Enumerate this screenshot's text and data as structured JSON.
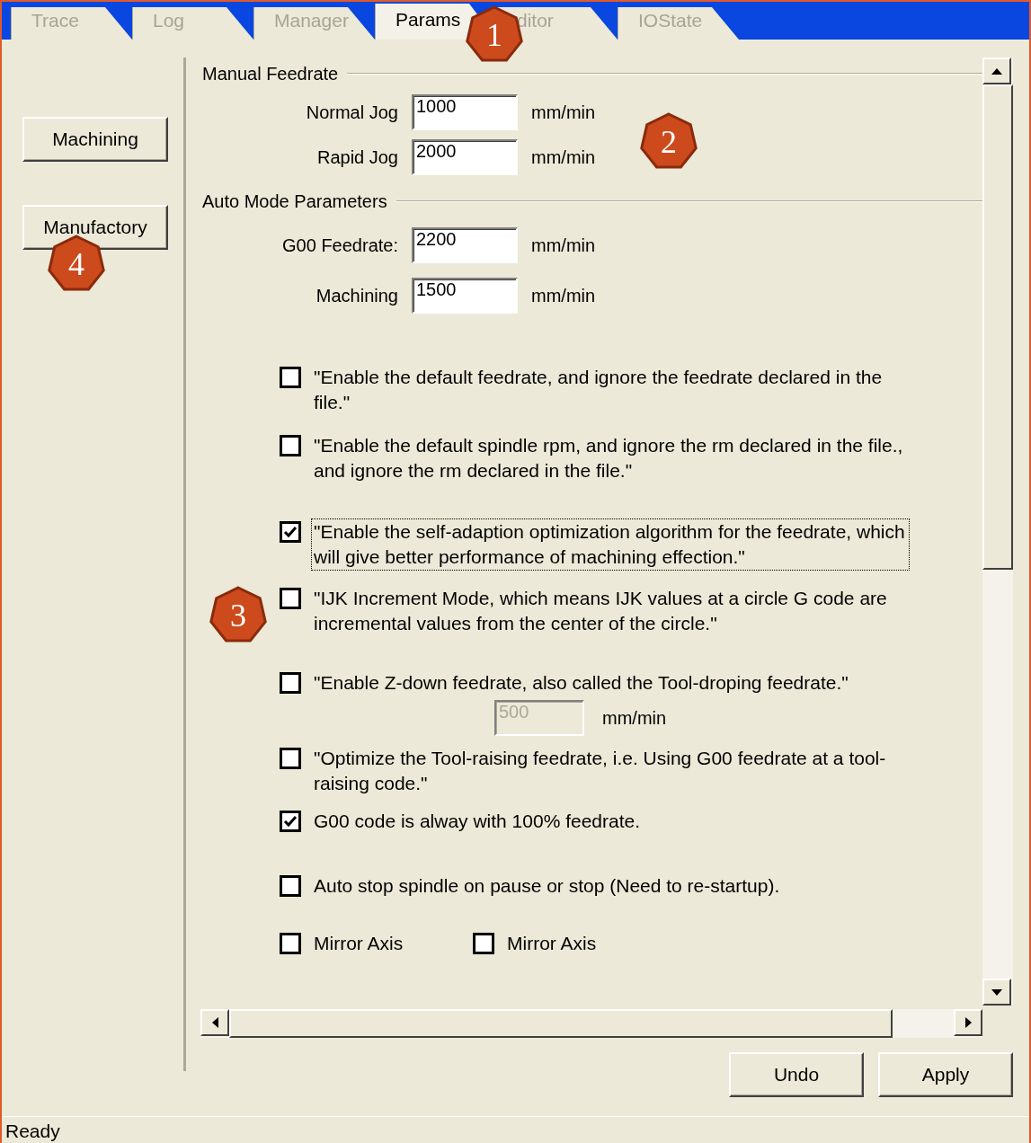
{
  "tabs": [
    {
      "label": "Trace",
      "selected": false
    },
    {
      "label": "Log",
      "selected": false
    },
    {
      "label": "Manager",
      "selected": false
    },
    {
      "label": "Params",
      "selected": true
    },
    {
      "label": "ditor",
      "selected": false
    },
    {
      "label": "IOState",
      "selected": false
    }
  ],
  "side_buttons": [
    {
      "label": "Machining"
    },
    {
      "label": "Manufactory"
    }
  ],
  "sections": [
    {
      "title": "Manual Feedrate",
      "fields": [
        {
          "label": "Normal Jog",
          "value": "1000",
          "unit": "mm/min"
        },
        {
          "label": "Rapid Jog",
          "value": "2000",
          "unit": "mm/min"
        }
      ]
    },
    {
      "title": "Auto Mode Parameters",
      "fields": [
        {
          "label": "G00 Feedrate:",
          "value": "2200",
          "unit": "mm/min"
        },
        {
          "label": "Machining",
          "value": "1500",
          "unit": "mm/min"
        }
      ]
    }
  ],
  "options": [
    {
      "kind": "checkbox",
      "text": "\"Enable the default feedrate, and ignore the feedrate declared in the file.\"",
      "checked": false
    },
    {
      "kind": "checkbox",
      "text": "\"Enable the default spindle rpm, and ignore the rm declared in the file., and ignore the rm declared in the file.\"",
      "checked": false
    },
    {
      "kind": "checkbox",
      "text": "\"Enable the self-adaption optimization algorithm for the feedrate, which will give better performance of machining effection.\"",
      "checked": true,
      "focused": true
    },
    {
      "kind": "checkbox",
      "text": "\"IJK Increment Mode, which means IJK values at a circle G code are incremental values from the center of the circle.\"",
      "checked": false
    },
    {
      "kind": "checkbox",
      "text": "\"Enable Z-down feedrate, also called the Tool-droping feedrate.\"",
      "checked": false
    },
    {
      "kind": "subfield",
      "value": "500",
      "unit": "mm/min",
      "disabled": true
    },
    {
      "kind": "checkbox",
      "text": "\"Optimize the Tool-raising feedrate, i.e. Using G00 feedrate at a tool-raising code.\"",
      "checked": false
    },
    {
      "kind": "checkbox",
      "text": "G00 code is alway with 100% feedrate.",
      "checked": true
    },
    {
      "kind": "checkbox",
      "text": "Auto stop spindle on pause or stop (Need to re-startup).",
      "checked": false
    },
    {
      "kind": "pair",
      "items": [
        {
          "text": "Mirror Axis",
          "checked": false
        },
        {
          "text": "Mirror Axis",
          "checked": false
        }
      ]
    }
  ],
  "footer_buttons": [
    {
      "label": "Undo"
    },
    {
      "label": "Apply"
    }
  ],
  "status_bar": "Ready",
  "markers": [
    "1",
    "2",
    "3",
    "4"
  ]
}
